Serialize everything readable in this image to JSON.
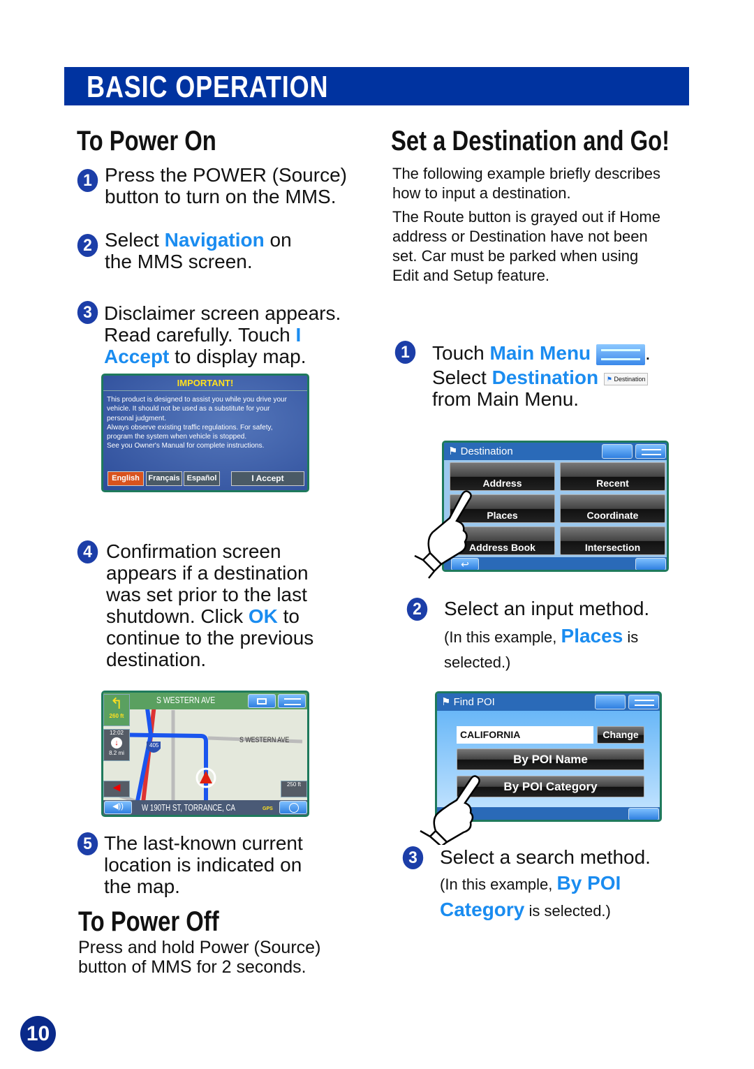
{
  "header": {
    "title": "BASIC OPERATION"
  },
  "power_on": {
    "title": "To Power On",
    "step1": {
      "num": "1",
      "l1": "Press the POWER (Source)",
      "l2": "button to turn on the MMS."
    },
    "step2": {
      "num": "2",
      "pre": "Select ",
      "hl": "Navigation",
      "post": " on",
      "l2": "the MMS screen."
    },
    "step3": {
      "num": "3",
      "l1": "Disclaimer screen appears.",
      "l2pre": "Read carefully. Touch ",
      "l2hl": "I",
      "l3hl": "Accept",
      "l3post": " to display map."
    },
    "step4": {
      "num": "4",
      "l1": "Confirmation screen",
      "l2": "appears if a destination",
      "l3": "was set prior to the last",
      "l4pre": "shutdown. Click ",
      "l4hl": "OK",
      "l4post": " to",
      "l5": "continue to the previous",
      "l6": "destination."
    },
    "step5": {
      "num": "5",
      "l1": "The last-known current",
      "l2": "location is indicated on",
      "l3": "the map."
    }
  },
  "disclaimer": {
    "title": "IMPORTANT!",
    "text": [
      "This product is designed to assist you while you drive your",
      "vehicle. It should not be used as a substitute for your",
      "personal judgment.",
      "Always observe existing traffic regulations. For safety,",
      "program the system when vehicle is stopped.",
      "See you Owner's Manual for complete instructions."
    ],
    "buttons": [
      "English",
      "Français",
      "Español"
    ],
    "accept": "I Accept"
  },
  "map": {
    "street_top": "S WESTERN AVE",
    "street_side": "S WESTERN AVE",
    "turn_distance": "260 ft",
    "time": "12:02",
    "remaining": "8.2 mi",
    "highway": "405",
    "scale": "250 ft",
    "location": "W 190TH ST, TORRANCE, CA",
    "gps": "GPS"
  },
  "power_off": {
    "title": "To Power Off",
    "l1": "Press and hold Power (Source)",
    "l2": "button of MMS for 2 seconds."
  },
  "destination_section": {
    "title": "Set a Destination and Go!",
    "p1": [
      "The following example briefly describes",
      "how to input a destination."
    ],
    "p2": [
      "The Route button is grayed out if Home",
      "address or Destination have not been",
      "set. Car must be parked when using",
      "Edit and Setup feature."
    ],
    "step1": {
      "num": "1",
      "pre": "Touch ",
      "hl": "Main Menu",
      "post": ".",
      "l2pre": "Select ",
      "l2hl": "Destination",
      "dest_chip": "Destination",
      "l3": "from Main Menu."
    },
    "step2": {
      "num": "2",
      "l1": "Select an input method.",
      "l2pre": "(In this example, ",
      "l2hl": "Places",
      "l2post": " is",
      "l3": "selected.)"
    },
    "step3": {
      "num": "3",
      "l1": "Select a search method.",
      "l2pre": "(In this example, ",
      "l2hl": "By POI",
      "l3hl": "Category",
      "l3post": " is selected.)"
    }
  },
  "dest_screen": {
    "title": "Destination",
    "buttons": [
      "Address",
      "Recent",
      "Places",
      "Coordinate",
      "Address Book",
      "Intersection"
    ]
  },
  "poi_screen": {
    "title": "Find POI",
    "state": "CALIFORNIA",
    "change": "Change",
    "by_name": "By POI Name",
    "by_category": "By POI Category"
  },
  "page_number": "10",
  "colors": {
    "header": "#0033a0",
    "accent": "#1a8cf0",
    "step_circle": "#1c3ea8"
  }
}
